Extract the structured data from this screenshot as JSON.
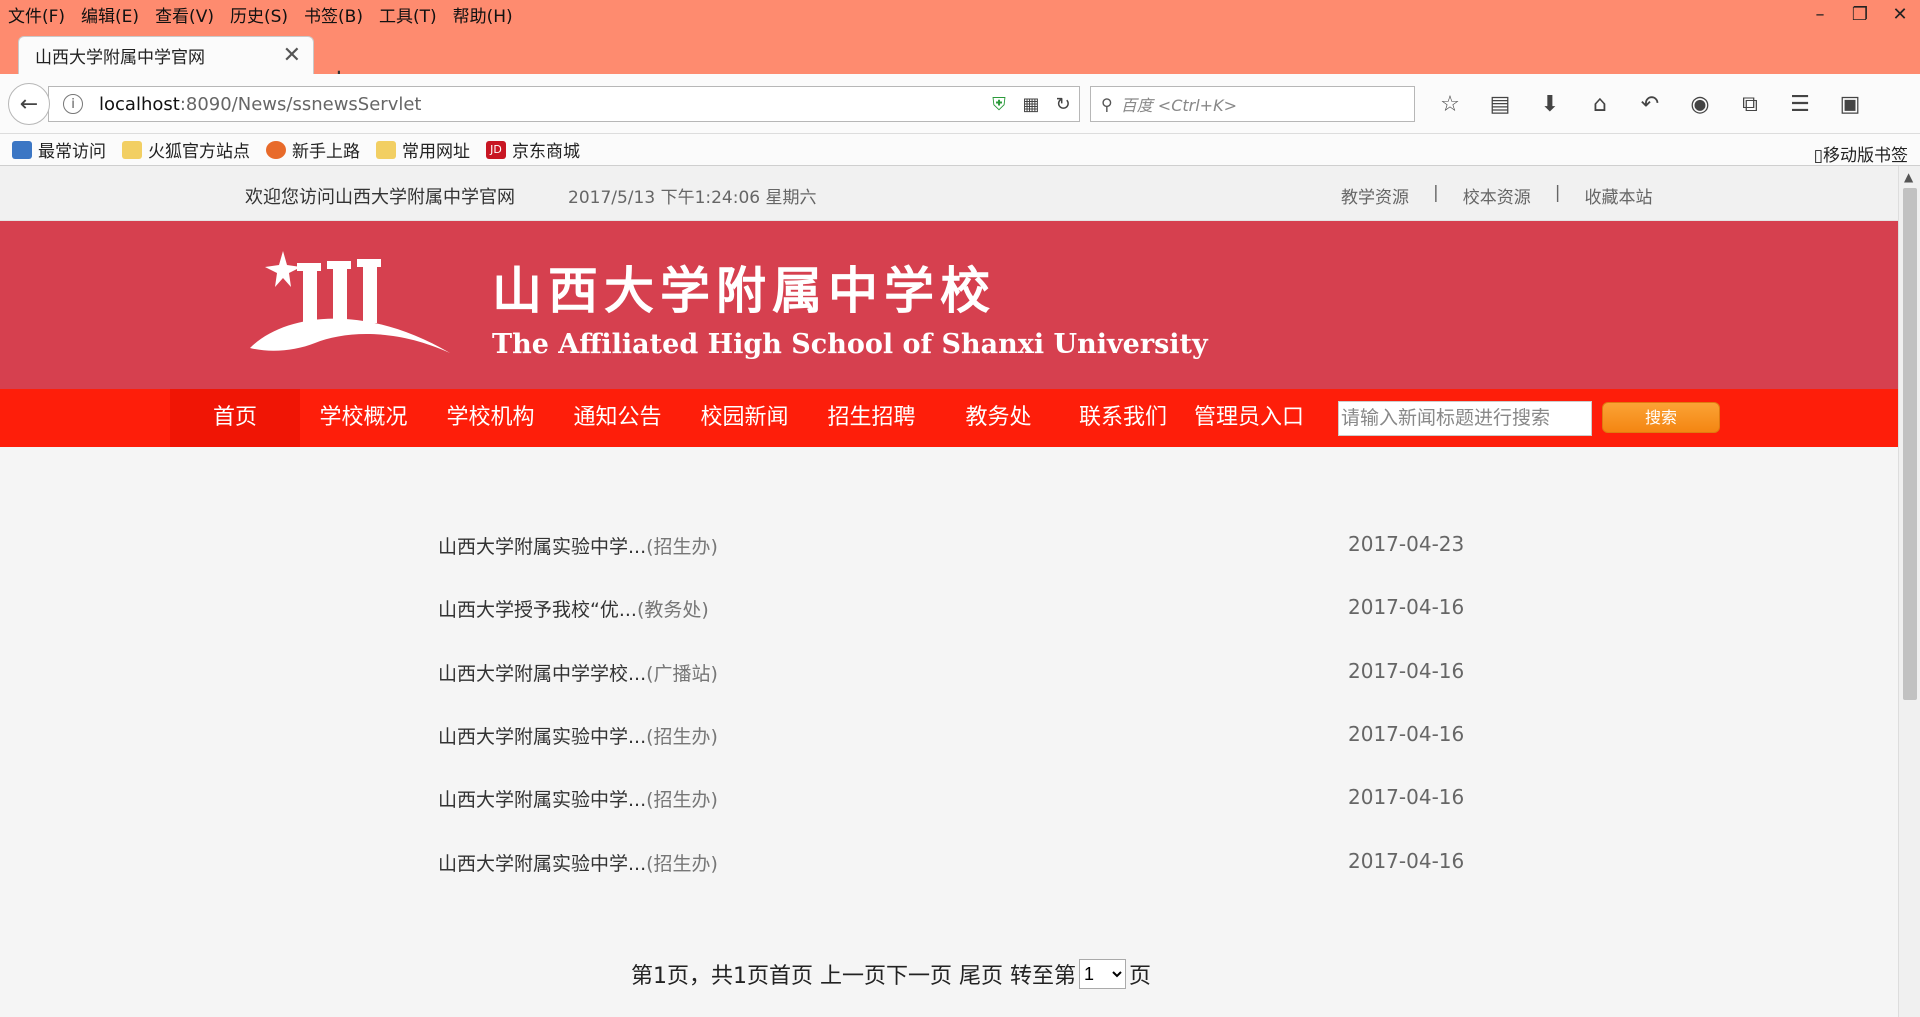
{
  "browser": {
    "menu": [
      "文件(F)",
      "编辑(E)",
      "查看(V)",
      "历史(S)",
      "书签(B)",
      "工具(T)",
      "帮助(H)"
    ],
    "tab_title": "山西大学附属中学官网",
    "url_host": "localhost",
    "url_rest": ":8090/News/ssnewsServlet",
    "search_placeholder": "百度 <Ctrl+K>",
    "bookmarks": [
      "最常访问",
      "火狐官方站点",
      "新手上路",
      "常用网址",
      "京东商城"
    ],
    "mobile_bookmarks": "移动版书签"
  },
  "site": {
    "welcome": "欢迎您访问山西大学附属中学官网",
    "datetime": "2017/5/13 下午1:24:06 星期六",
    "top_links": [
      "教学资源",
      "校本资源",
      "收藏本站"
    ],
    "separator": "|",
    "cn_name": "山西大学附属中学校",
    "en_name": "The Affiliated High School of Shanxi University",
    "nav": [
      "首页",
      "学校概况",
      "学校机构",
      "通知公告",
      "校园新闻",
      "招生招聘",
      "教务处",
      "联系我们",
      "管理员入口"
    ],
    "search_placeholder": "请输入新闻标题进行搜索",
    "search_button": "搜索"
  },
  "news": [
    {
      "title": "山西大学附属实验中学...",
      "dept": "(招生办)",
      "date": "2017-04-23"
    },
    {
      "title": "山西大学授予我校“优...",
      "dept": "(教务处)",
      "date": "2017-04-16"
    },
    {
      "title": "山西大学附属中学学校...",
      "dept": "(广播站)",
      "date": "2017-04-16"
    },
    {
      "title": "山西大学附属实验中学...",
      "dept": "(招生办)",
      "date": "2017-04-16"
    },
    {
      "title": "山西大学附属实验中学...",
      "dept": "(招生办)",
      "date": "2017-04-16"
    },
    {
      "title": "山西大学附属实验中学...",
      "dept": "(招生办)",
      "date": "2017-04-16"
    }
  ],
  "pager": {
    "text_before": "第1页，共1页首页 上一页下一页 尾页 转至第",
    "selected": "1",
    "text_after": "页"
  },
  "colors": {
    "banner": "#d6404f",
    "nav": "#fe1e0a",
    "browser_chrome": "#fe8b6f",
    "search_button": "#f48612"
  }
}
